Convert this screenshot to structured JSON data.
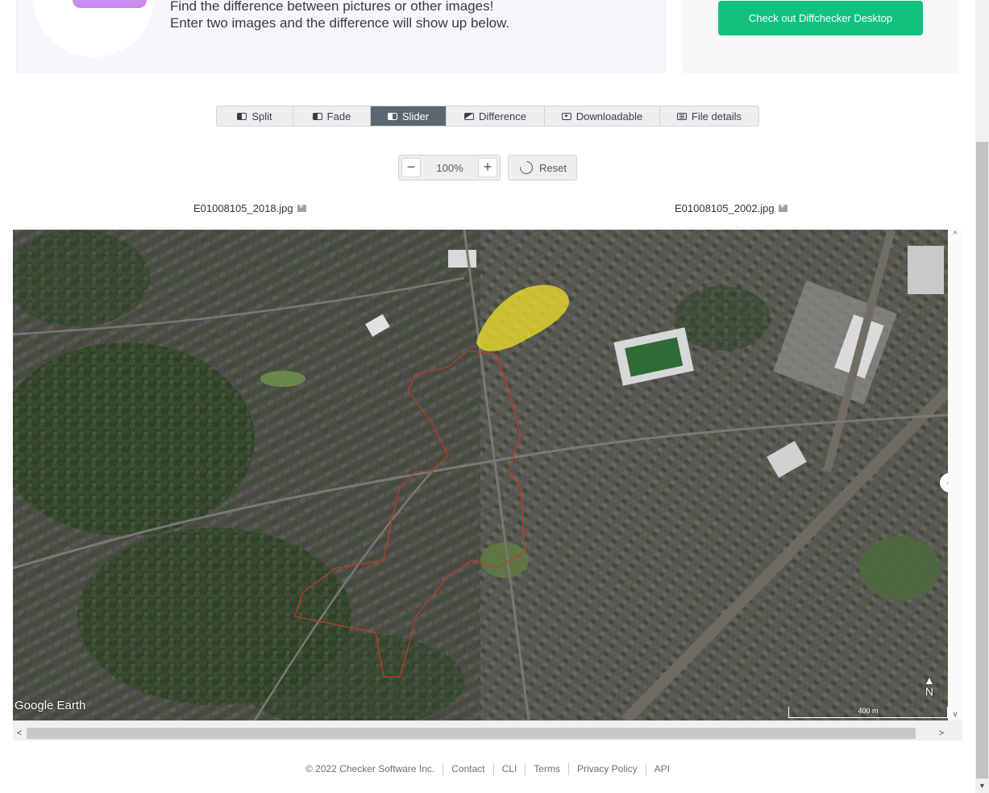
{
  "hero": {
    "line1": "Find the difference between pictures or other images!",
    "line2": "Enter two images and the difference will show up below."
  },
  "promo": {
    "button_label": "Check out Diffchecker Desktop"
  },
  "view_tabs": {
    "split": "Split",
    "fade": "Fade",
    "slider": "Slider",
    "difference": "Difference",
    "downloadable": "Downloadable",
    "file_details": "File details",
    "active": "Slider"
  },
  "zoom": {
    "value": "100%",
    "reset_label": "Reset"
  },
  "files": {
    "left": "E01008105_2018.jpg",
    "right": "E01008105_2002.jpg"
  },
  "map": {
    "watermark": "Google Earth",
    "north": "N",
    "scale_label": "400 m"
  },
  "footer": {
    "copyright": "© 2022 Checker Software Inc.",
    "links": [
      "Contact",
      "CLI",
      "Terms",
      "Privacy Policy",
      "API"
    ]
  },
  "colors": {
    "accent": "#11c27e",
    "active_tab": "#5b6670",
    "boundary": "#c0392b",
    "highlight": "#f2e12a"
  }
}
